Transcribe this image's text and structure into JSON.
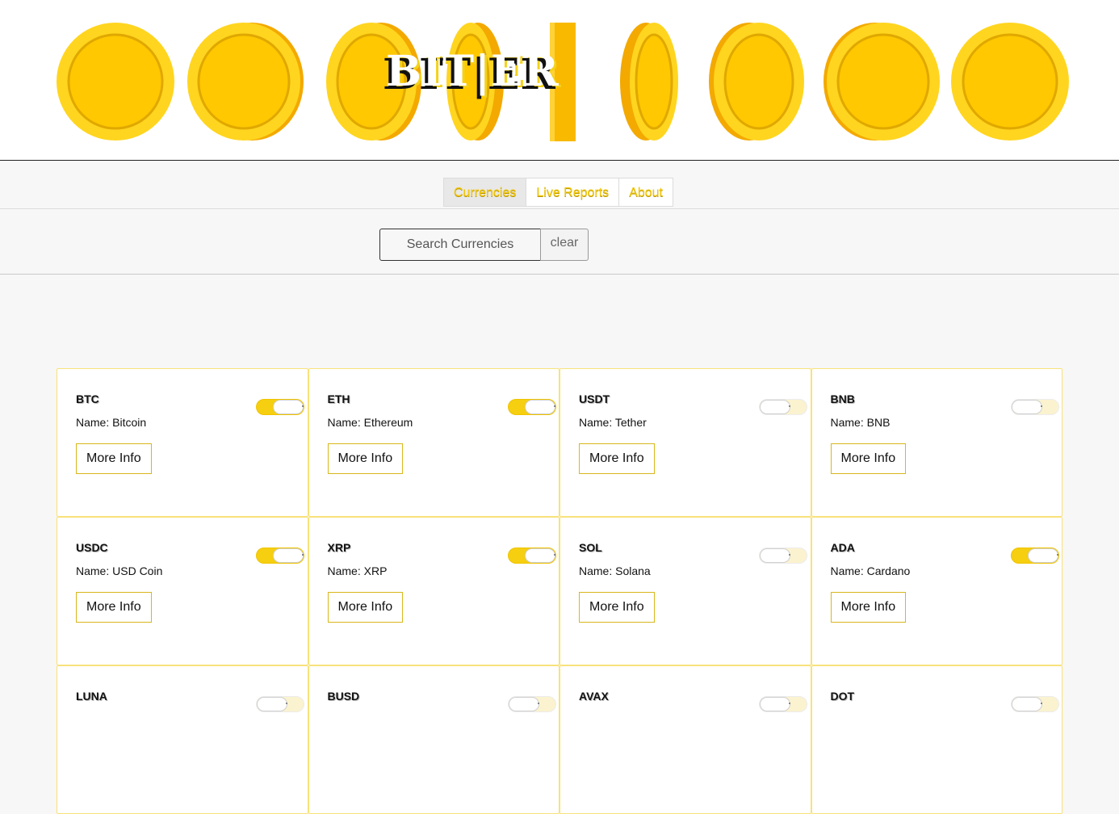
{
  "header": {
    "brand": "BIT|ER"
  },
  "nav": {
    "tabs": [
      "Currencies",
      "Live Reports",
      "About"
    ],
    "active_tab": "Currencies"
  },
  "search": {
    "placeholder": "Search Currencies",
    "value": "",
    "clear_label": "clear"
  },
  "cards": [
    {
      "symbol": "BTC",
      "name": "Name: Bitcoin",
      "button": "More Info",
      "toggle_on": true
    },
    {
      "symbol": "ETH",
      "name": "Name: Ethereum",
      "button": "More Info",
      "toggle_on": true
    },
    {
      "symbol": "USDT",
      "name": "Name: Tether",
      "button": "More Info",
      "toggle_on": false
    },
    {
      "symbol": "BNB",
      "name": "Name: BNB",
      "button": "More Info",
      "toggle_on": false
    },
    {
      "symbol": "USDC",
      "name": "Name: USD Coin",
      "button": "More Info",
      "toggle_on": true
    },
    {
      "symbol": "XRP",
      "name": "Name: XRP",
      "button": "More Info",
      "toggle_on": true
    },
    {
      "symbol": "SOL",
      "name": "Name: Solana",
      "button": "More Info",
      "toggle_on": false
    },
    {
      "symbol": "ADA",
      "name": "Name: Cardano",
      "button": "More Info",
      "toggle_on": true
    },
    {
      "symbol": "LUNA",
      "name": "",
      "button": "",
      "toggle_on": false
    },
    {
      "symbol": "BUSD",
      "name": "",
      "button": "",
      "toggle_on": false
    },
    {
      "symbol": "AVAX",
      "name": "",
      "button": "",
      "toggle_on": false
    },
    {
      "symbol": "DOT",
      "name": "",
      "button": "",
      "toggle_on": false
    }
  ],
  "colors": {
    "accent": "#f5cf10",
    "card_border": "#f8e27a",
    "coin": "#ffcc00"
  }
}
